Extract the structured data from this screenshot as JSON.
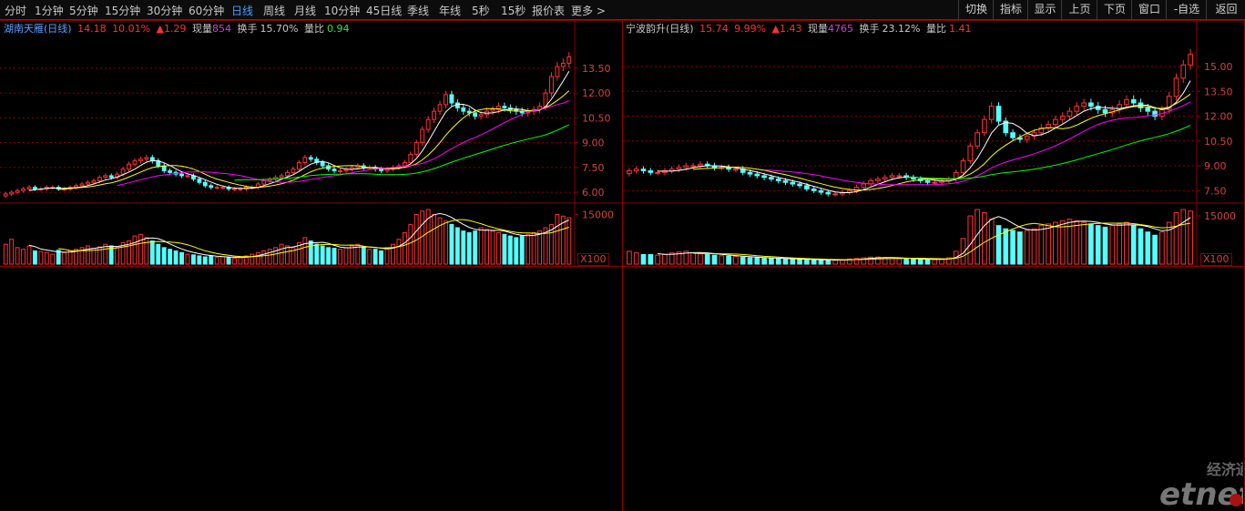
{
  "toolbar": {
    "periods": [
      {
        "label": "分时",
        "name": "period-fenshi"
      },
      {
        "label": "1分钟",
        "name": "period-1min"
      },
      {
        "label": "5分钟",
        "name": "period-5min"
      },
      {
        "label": "15分钟",
        "name": "period-15min"
      },
      {
        "label": "30分钟",
        "name": "period-30min"
      },
      {
        "label": "60分钟",
        "name": "period-60min"
      },
      {
        "label": "日线",
        "name": "period-daily"
      },
      {
        "label": "周线",
        "name": "period-weekly"
      },
      {
        "label": "月线",
        "name": "period-monthly"
      },
      {
        "label": "10分钟",
        "name": "period-10min"
      },
      {
        "label": "45日线",
        "name": "period-45day"
      },
      {
        "label": "季线",
        "name": "period-quarterly"
      },
      {
        "label": "年线",
        "name": "period-yearly"
      },
      {
        "label": "5秒",
        "name": "period-5sec"
      },
      {
        "label": "15秒",
        "name": "period-15sec"
      },
      {
        "label": "报价表",
        "name": "quote-table"
      },
      {
        "label": "更多 >",
        "name": "more-menu"
      }
    ],
    "active_period": "日线",
    "right_buttons": [
      {
        "label": "切换",
        "name": "switch-button"
      },
      {
        "label": "指标",
        "name": "indicator-button"
      },
      {
        "label": "显示",
        "name": "display-button"
      },
      {
        "label": "上页",
        "name": "prev-page-button"
      },
      {
        "label": "下页",
        "name": "next-page-button"
      },
      {
        "label": "窗口",
        "name": "window-button"
      },
      {
        "label": "-自选",
        "name": "remove-watchlist-button"
      },
      {
        "label": "返回",
        "name": "back-button"
      }
    ]
  },
  "colors": {
    "up": "#ff3232",
    "down": "#54ffff",
    "ma5": "#ffffff",
    "ma10": "#ffff00",
    "ma20": "#ff00ff",
    "ma60": "#00ff00",
    "grid": "#8b0000",
    "axis": "#d84040"
  },
  "left": {
    "name": "湖南天雁",
    "period": "(日线)",
    "price": "14.18",
    "pct": "10.01%",
    "change": "▲1.29",
    "vol_label": "现量",
    "vol": "854",
    "turnover_label": "换手",
    "turnover": "15.70%",
    "ratio_label": "量比",
    "ratio": "0.94",
    "y_ticks": [
      "13.50",
      "12.00",
      "10.50",
      "9.00",
      "7.50",
      "6.00"
    ],
    "vol_tick": "15000",
    "multiplier": "X100"
  },
  "right": {
    "name": "宁波韵升",
    "period": "(日线)",
    "price": "15.74",
    "pct": "9.99%",
    "change": "▲1.43",
    "vol_label": "现量",
    "vol": "4765",
    "turnover_label": "换手",
    "turnover": "23.12%",
    "ratio_label": "量比",
    "ratio": "1.41",
    "y_ticks": [
      "15.00",
      "13.50",
      "12.00",
      "10.50",
      "9.00",
      "7.50"
    ],
    "vol_tick": "15000",
    "multiplier": "X100"
  },
  "chart_data": [
    {
      "type": "candlestick",
      "title": "湖南天雁(日线)",
      "ylim": [
        5.4,
        15.2
      ],
      "close": [
        5.9,
        6.0,
        6.1,
        6.2,
        6.3,
        6.2,
        6.2,
        6.3,
        6.3,
        6.2,
        6.2,
        6.3,
        6.4,
        6.5,
        6.6,
        6.7,
        6.9,
        7.0,
        6.9,
        7.1,
        7.4,
        7.7,
        7.9,
        8.0,
        8.1,
        7.9,
        7.6,
        7.3,
        7.2,
        7.1,
        7.0,
        7.0,
        6.8,
        6.6,
        6.4,
        6.3,
        6.3,
        6.3,
        6.2,
        6.2,
        6.2,
        6.3,
        6.3,
        6.5,
        6.7,
        6.8,
        6.9,
        7.0,
        7.2,
        7.4,
        7.8,
        8.1,
        8.0,
        7.8,
        7.6,
        7.4,
        7.3,
        7.3,
        7.4,
        7.5,
        7.6,
        7.5,
        7.5,
        7.4,
        7.3,
        7.4,
        7.5,
        7.6,
        7.8,
        8.3,
        9.0,
        9.8,
        10.4,
        10.9,
        11.3,
        11.9,
        11.4,
        11.1,
        10.9,
        10.8,
        10.6,
        10.7,
        10.9,
        11.0,
        11.2,
        11.1,
        11.0,
        10.9,
        10.8,
        10.9,
        11.0,
        11.2,
        12.0,
        13.0,
        13.6,
        13.8,
        14.18
      ],
      "volume": [
        60,
        75,
        50,
        45,
        55,
        40,
        38,
        35,
        30,
        42,
        35,
        40,
        45,
        50,
        55,
        48,
        52,
        60,
        55,
        50,
        65,
        70,
        85,
        90,
        80,
        70,
        60,
        50,
        45,
        40,
        35,
        30,
        28,
        25,
        22,
        25,
        20,
        22,
        20,
        18,
        20,
        25,
        30,
        35,
        40,
        45,
        50,
        60,
        55,
        50,
        65,
        80,
        70,
        60,
        55,
        50,
        48,
        45,
        50,
        55,
        60,
        50,
        45,
        45,
        40,
        50,
        60,
        75,
        95,
        120,
        150,
        160,
        165,
        150,
        140,
        130,
        120,
        110,
        100,
        95,
        100,
        110,
        105,
        100,
        95,
        90,
        85,
        80,
        85,
        90,
        95,
        100,
        110,
        120,
        150,
        145,
        140
      ]
    },
    {
      "type": "candlestick",
      "title": "宁波韵升(日线)",
      "ylim": [
        6.8,
        16.6
      ],
      "close": [
        8.7,
        8.8,
        8.7,
        8.6,
        8.6,
        8.7,
        8.8,
        8.9,
        9.0,
        9.0,
        9.1,
        9.0,
        8.9,
        8.9,
        8.8,
        8.8,
        8.6,
        8.5,
        8.4,
        8.3,
        8.2,
        8.1,
        8.0,
        7.9,
        7.8,
        7.6,
        7.5,
        7.4,
        7.3,
        7.3,
        7.4,
        7.5,
        7.7,
        7.9,
        8.1,
        8.2,
        8.3,
        8.4,
        8.4,
        8.3,
        8.2,
        8.1,
        8.0,
        8.0,
        8.1,
        8.2,
        8.6,
        9.3,
        10.2,
        11.0,
        11.8,
        12.6,
        11.7,
        11.0,
        10.7,
        10.6,
        10.8,
        11.0,
        11.3,
        11.5,
        11.8,
        12.0,
        12.3,
        12.6,
        12.8,
        12.6,
        12.4,
        12.2,
        12.4,
        12.7,
        13.0,
        12.8,
        12.5,
        12.3,
        12.0,
        12.4,
        13.2,
        14.3,
        15.1,
        15.74
      ],
      "volume": [
        40,
        35,
        30,
        30,
        28,
        30,
        35,
        38,
        40,
        35,
        32,
        30,
        28,
        26,
        25,
        24,
        22,
        20,
        20,
        18,
        18,
        17,
        16,
        15,
        14,
        14,
        13,
        13,
        12,
        12,
        14,
        16,
        18,
        20,
        22,
        22,
        20,
        18,
        17,
        16,
        15,
        15,
        14,
        14,
        16,
        20,
        40,
        80,
        150,
        170,
        160,
        140,
        120,
        110,
        105,
        100,
        105,
        110,
        120,
        125,
        130,
        135,
        140,
        135,
        130,
        125,
        120,
        115,
        120,
        125,
        130,
        120,
        110,
        100,
        90,
        100,
        130,
        160,
        170,
        165
      ]
    }
  ]
}
